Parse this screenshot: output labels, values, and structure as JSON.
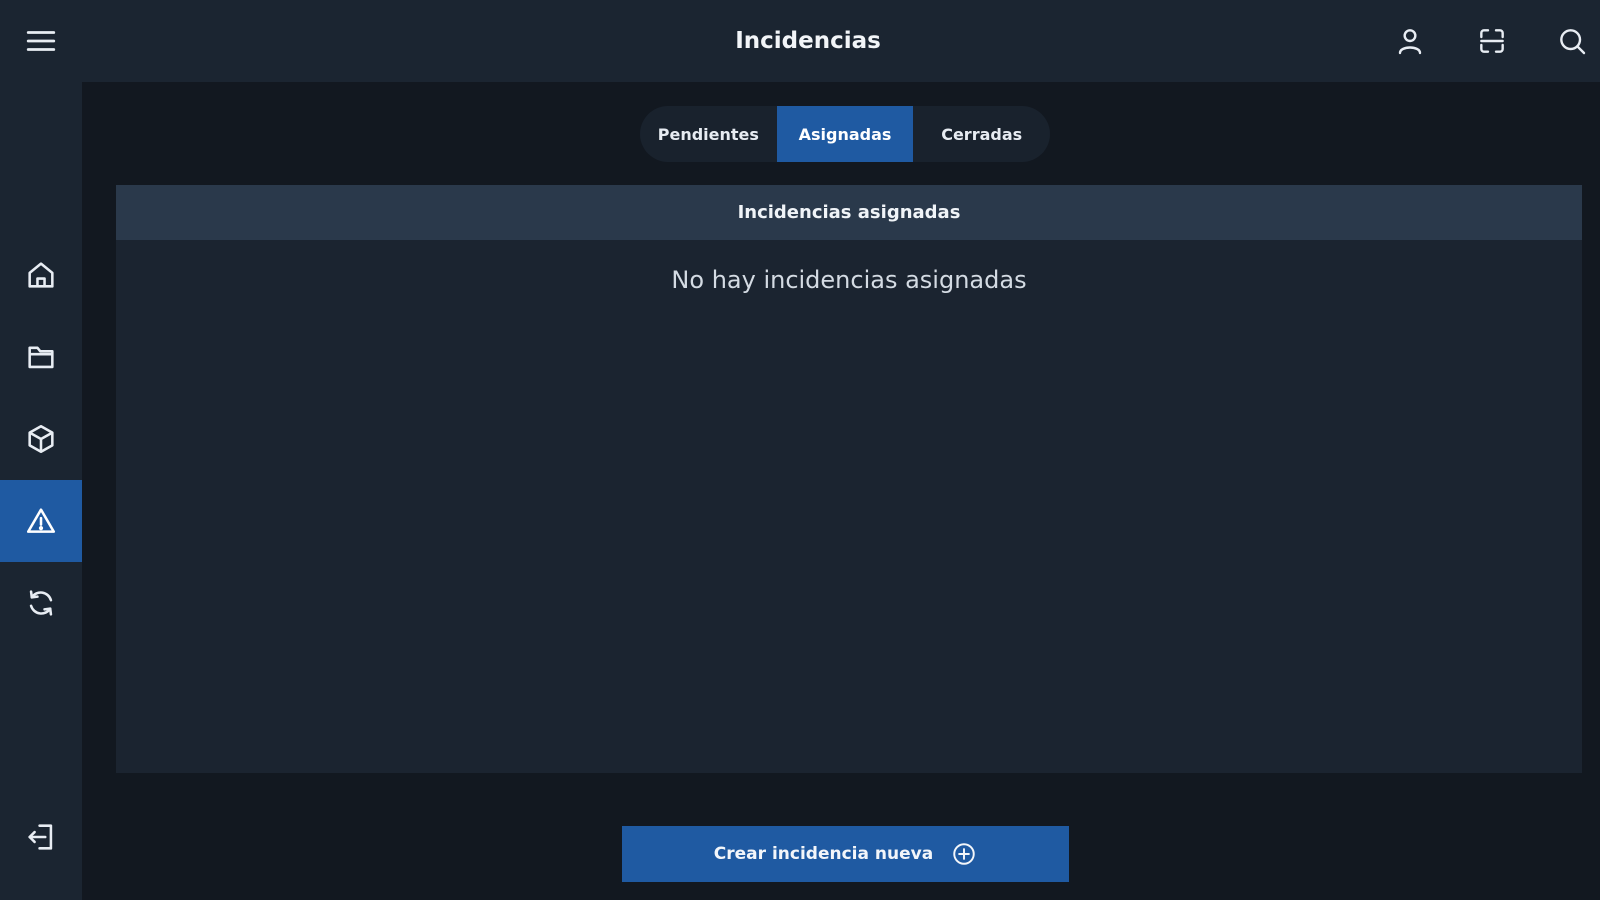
{
  "app": {
    "title": "Incidencias"
  },
  "sidebar": {
    "items": [
      {
        "icon": "menu-icon"
      },
      {
        "icon": "home-icon"
      },
      {
        "icon": "folder-icon"
      },
      {
        "icon": "cube-icon"
      },
      {
        "icon": "warning-icon",
        "active": true
      },
      {
        "icon": "sync-icon"
      },
      {
        "icon": "logout-icon"
      }
    ]
  },
  "topbar": {
    "actions": [
      {
        "icon": "user-icon"
      },
      {
        "icon": "scan-icon"
      },
      {
        "icon": "search-icon"
      }
    ]
  },
  "tabs": [
    {
      "label": "Pendientes",
      "active": false
    },
    {
      "label": "Asignadas",
      "active": true
    },
    {
      "label": "Cerradas",
      "active": false
    }
  ],
  "panel": {
    "header": "Incidencias asignadas",
    "empty_message": "No hay incidencias asignadas"
  },
  "actions": {
    "create_label": "Crear incidencia nueva"
  },
  "colors": {
    "accent": "#1f5aa2",
    "background": "#121820",
    "sidebar": "#1b2531",
    "panel_header": "#2a394b"
  }
}
